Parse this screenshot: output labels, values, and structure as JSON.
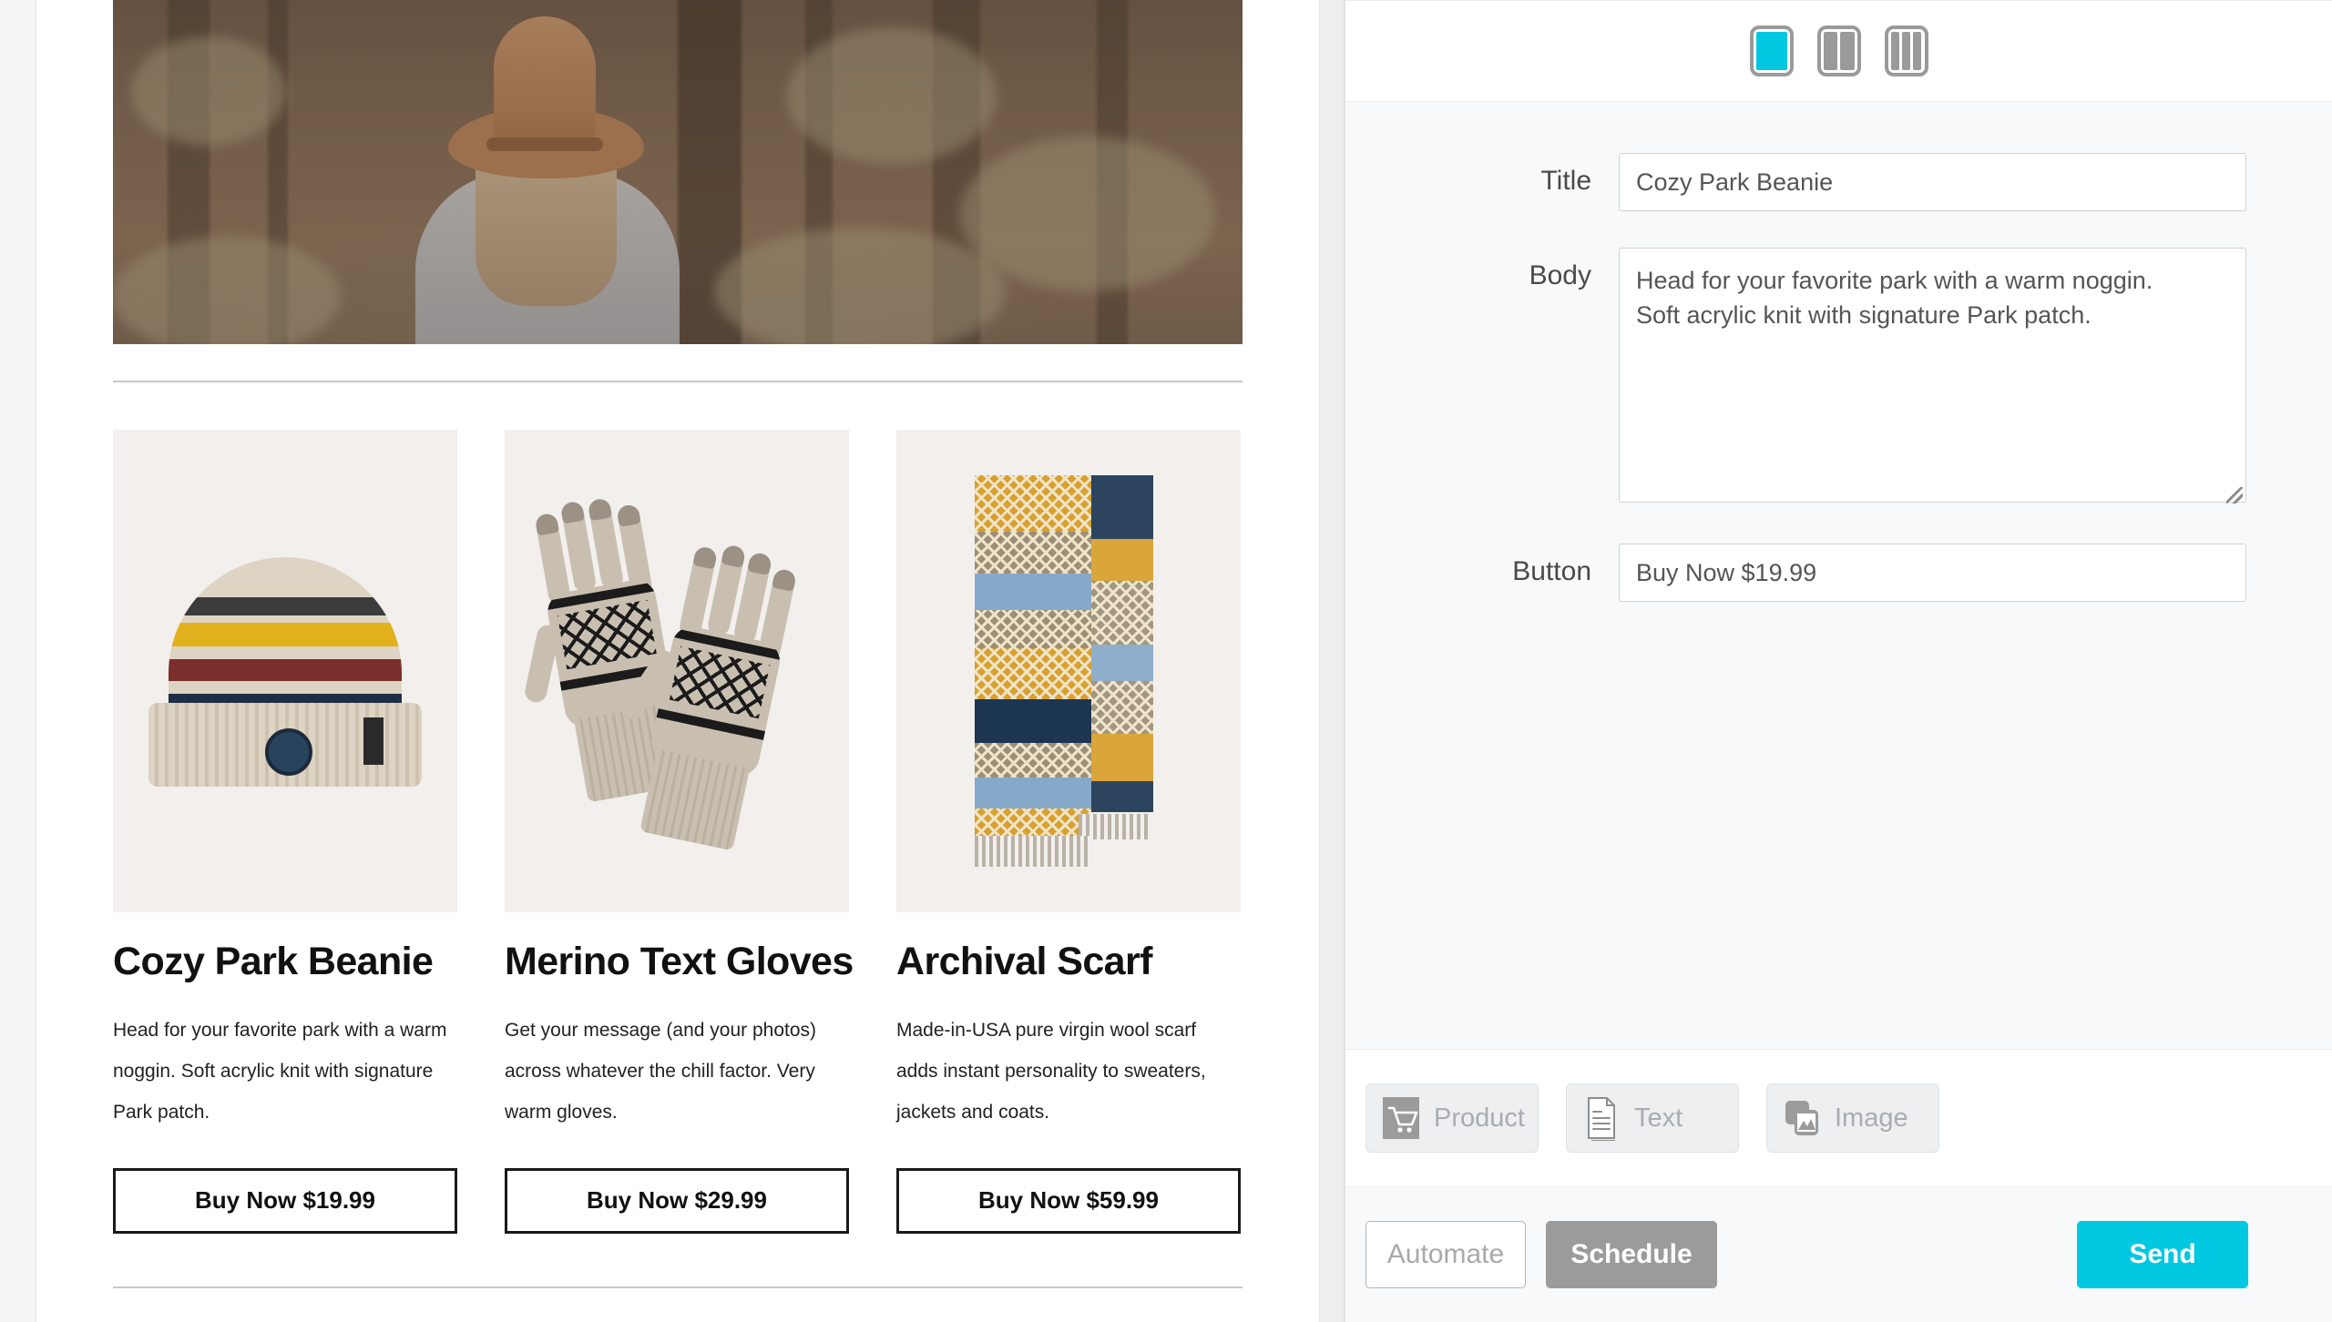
{
  "preview": {
    "hero": {
      "alt": "woman in brown felt hat and denim shirt facing away in a sepia forest"
    },
    "products": [
      {
        "name": "Cozy Park Beanie",
        "description": "Head for your favorite park with a warm noggin. Soft acrylic knit with signature Park patch.",
        "button": "Buy Now $19.99",
        "image_alt": "cream striped knit beanie"
      },
      {
        "name": "Merino Text Gloves",
        "description": "Get your message (and your photos) across whatever the chill factor. Very warm gloves.",
        "button": "Buy Now $29.99",
        "image_alt": "beige knit gloves with black pattern"
      },
      {
        "name": "Archival Scarf",
        "description": "Made-in-USA pure virgin wool scarf adds instant personality to sweaters, jackets and coats.",
        "button": "Buy Now $59.99",
        "image_alt": "navy and gold geometric wool scarf"
      }
    ]
  },
  "editor": {
    "layout_options": [
      {
        "name": "one-column",
        "columns": 1,
        "selected": true
      },
      {
        "name": "two-column",
        "columns": 2,
        "selected": false
      },
      {
        "name": "three-column",
        "columns": 3,
        "selected": false
      }
    ],
    "fields": {
      "title_label": "Title",
      "title_value": "Cozy Park Beanie",
      "body_label": "Body",
      "body_value": "Head for your favorite park with a warm noggin.\nSoft acrylic knit with signature Park patch.",
      "button_label": "Button",
      "button_value": "Buy Now $19.99"
    },
    "blocks": [
      {
        "label": "Product",
        "icon": "cart-icon"
      },
      {
        "label": "Text",
        "icon": "document-icon"
      },
      {
        "label": "Image",
        "icon": "image-icon"
      }
    ],
    "actions": {
      "automate": "Automate",
      "schedule": "Schedule",
      "send": "Send"
    }
  },
  "colors": {
    "accent": "#00c8e0",
    "schedule_gray": "#9b9b9b",
    "panel_bg": "#f7f9fa"
  }
}
